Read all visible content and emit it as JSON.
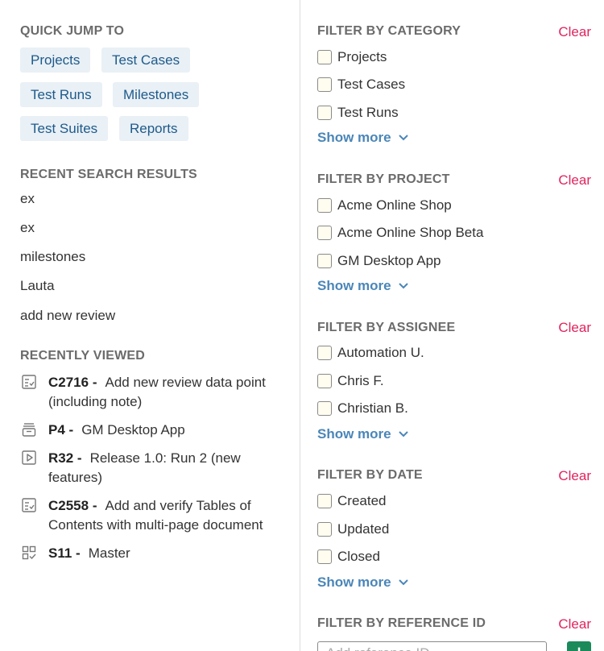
{
  "quick_jump": {
    "title": "QUICK JUMP TO",
    "chips": [
      "Projects",
      "Test Cases",
      "Test Runs",
      "Milestones",
      "Test Suites",
      "Reports"
    ]
  },
  "recent_search": {
    "title": "RECENT SEARCH RESULTS",
    "items": [
      "ex",
      "ex",
      "milestones",
      "Lauta",
      "add new review"
    ]
  },
  "recently_viewed": {
    "title": "RECENTLY VIEWED",
    "items": [
      {
        "icon": "test-case-icon",
        "id": "C2716",
        "text": "Add new review data point (including note)"
      },
      {
        "icon": "project-icon",
        "id": "P4",
        "text": "GM Desktop App"
      },
      {
        "icon": "test-run-icon",
        "id": "R32",
        "text": "Release 1.0: Run 2 (new features)"
      },
      {
        "icon": "test-case-icon",
        "id": "C2558",
        "text": "Add and verify Tables of Contents with multi-page document"
      },
      {
        "icon": "test-suite-icon",
        "id": "S11",
        "text": "Master"
      }
    ]
  },
  "filters": {
    "clear_label": "Clear",
    "show_more_label": "Show more",
    "category": {
      "title": "FILTER BY CATEGORY",
      "options": [
        "Projects",
        "Test Cases",
        "Test Runs"
      ]
    },
    "project": {
      "title": "FILTER BY PROJECT",
      "options": [
        "Acme Online Shop",
        "Acme Online Shop Beta",
        "GM Desktop App"
      ]
    },
    "assignee": {
      "title": "FILTER BY ASSIGNEE",
      "options": [
        "Automation U.",
        "Chris F.",
        "Christian B."
      ]
    },
    "date": {
      "title": "FILTER BY DATE",
      "options": [
        "Created",
        "Updated",
        "Closed"
      ]
    },
    "reference": {
      "title": "FILTER BY REFERENCE ID",
      "placeholder": "Add reference ID",
      "add_label": "+"
    }
  },
  "colors": {
    "accent": "#4a86b8",
    "clear": "#e0245e",
    "chip_bg": "#e9f0f6",
    "add_button": "#1a8a5a"
  }
}
